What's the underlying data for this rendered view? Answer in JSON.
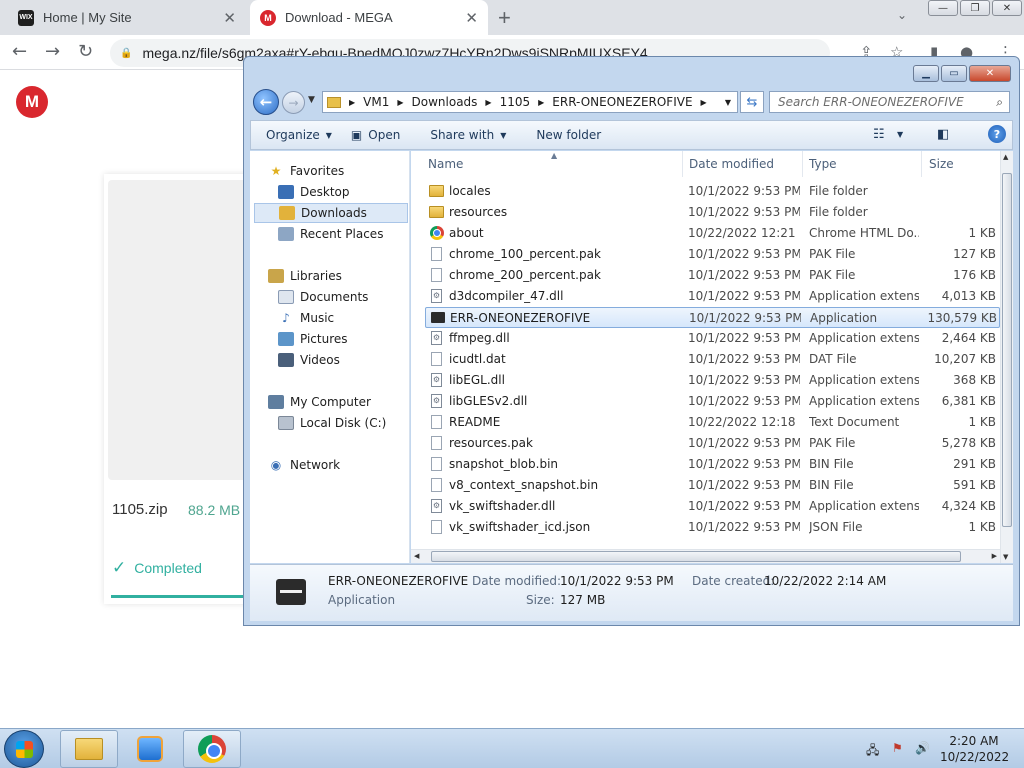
{
  "browser": {
    "tabs": [
      {
        "favicon": "WIX",
        "title": "Home | My Site"
      },
      {
        "favicon": "M",
        "title": "Download - MEGA"
      }
    ],
    "url": "mega.nz/file/s6gm2axa#rY-ebqu-BpedMOJ0zwz7HcYRn2Dws9iSNRpMIUXSEY4"
  },
  "mega": {
    "logo": "M",
    "file_name": "1105.zip",
    "file_size": "88.2 MB",
    "status": "Completed",
    "progress_percent": 100
  },
  "explorer": {
    "breadcrumb": [
      "VM1",
      "Downloads",
      "1105",
      "ERR-ONEONEZEROFIVE"
    ],
    "search_placeholder": "Search ERR-ONEONEZEROFIVE",
    "commands": {
      "organize": "Organize",
      "open": "Open",
      "share_with": "Share with",
      "new_folder": "New folder"
    },
    "nav": {
      "favorites": "Favorites",
      "desktop": "Desktop",
      "downloads": "Downloads",
      "recent_places": "Recent Places",
      "libraries": "Libraries",
      "documents": "Documents",
      "music": "Music",
      "pictures": "Pictures",
      "videos": "Videos",
      "my_computer": "My Computer",
      "local_disk": "Local Disk (C:)",
      "network": "Network"
    },
    "columns": {
      "name": "Name",
      "date": "Date modified",
      "type": "Type",
      "size": "Size"
    },
    "files": [
      {
        "icon": "folder",
        "name": "locales",
        "date": "10/1/2022 9:53 PM",
        "type": "File folder",
        "size": ""
      },
      {
        "icon": "folder",
        "name": "resources",
        "date": "10/1/2022 9:53 PM",
        "type": "File folder",
        "size": ""
      },
      {
        "icon": "chrome",
        "name": "about",
        "date": "10/22/2022 12:21 ...",
        "type": "Chrome HTML Do...",
        "size": "1 KB"
      },
      {
        "icon": "file",
        "name": "chrome_100_percent.pak",
        "date": "10/1/2022 9:53 PM",
        "type": "PAK File",
        "size": "127 KB"
      },
      {
        "icon": "file",
        "name": "chrome_200_percent.pak",
        "date": "10/1/2022 9:53 PM",
        "type": "PAK File",
        "size": "176 KB"
      },
      {
        "icon": "dll",
        "name": "d3dcompiler_47.dll",
        "date": "10/1/2022 9:53 PM",
        "type": "Application extens...",
        "size": "4,013 KB"
      },
      {
        "icon": "app",
        "name": "ERR-ONEONEZEROFIVE",
        "date": "10/1/2022 9:53 PM",
        "type": "Application",
        "size": "130,579 KB",
        "selected": true
      },
      {
        "icon": "dll",
        "name": "ffmpeg.dll",
        "date": "10/1/2022 9:53 PM",
        "type": "Application extens...",
        "size": "2,464 KB"
      },
      {
        "icon": "file",
        "name": "icudtl.dat",
        "date": "10/1/2022 9:53 PM",
        "type": "DAT File",
        "size": "10,207 KB"
      },
      {
        "icon": "dll",
        "name": "libEGL.dll",
        "date": "10/1/2022 9:53 PM",
        "type": "Application extens...",
        "size": "368 KB"
      },
      {
        "icon": "dll",
        "name": "libGLESv2.dll",
        "date": "10/1/2022 9:53 PM",
        "type": "Application extens...",
        "size": "6,381 KB"
      },
      {
        "icon": "file",
        "name": "README",
        "date": "10/22/2022 12:18 ...",
        "type": "Text Document",
        "size": "1 KB"
      },
      {
        "icon": "file",
        "name": "resources.pak",
        "date": "10/1/2022 9:53 PM",
        "type": "PAK File",
        "size": "5,278 KB"
      },
      {
        "icon": "file",
        "name": "snapshot_blob.bin",
        "date": "10/1/2022 9:53 PM",
        "type": "BIN File",
        "size": "291 KB"
      },
      {
        "icon": "file",
        "name": "v8_context_snapshot.bin",
        "date": "10/1/2022 9:53 PM",
        "type": "BIN File",
        "size": "591 KB"
      },
      {
        "icon": "dll",
        "name": "vk_swiftshader.dll",
        "date": "10/1/2022 9:53 PM",
        "type": "Application extens...",
        "size": "4,324 KB"
      },
      {
        "icon": "file",
        "name": "vk_swiftshader_icd.json",
        "date": "10/1/2022 9:53 PM",
        "type": "JSON File",
        "size": "1 KB"
      }
    ],
    "details": {
      "name": "ERR-ONEONEZEROFIVE",
      "kind": "Application",
      "date_modified_label": "Date modified:",
      "date_modified": "10/1/2022 9:53 PM",
      "date_created_label": "Date created:",
      "date_created": "10/22/2022 2:14 AM",
      "size_label": "Size:",
      "size": "127 MB"
    }
  },
  "taskbar": {
    "time": "2:20 AM",
    "date": "10/22/2022"
  }
}
